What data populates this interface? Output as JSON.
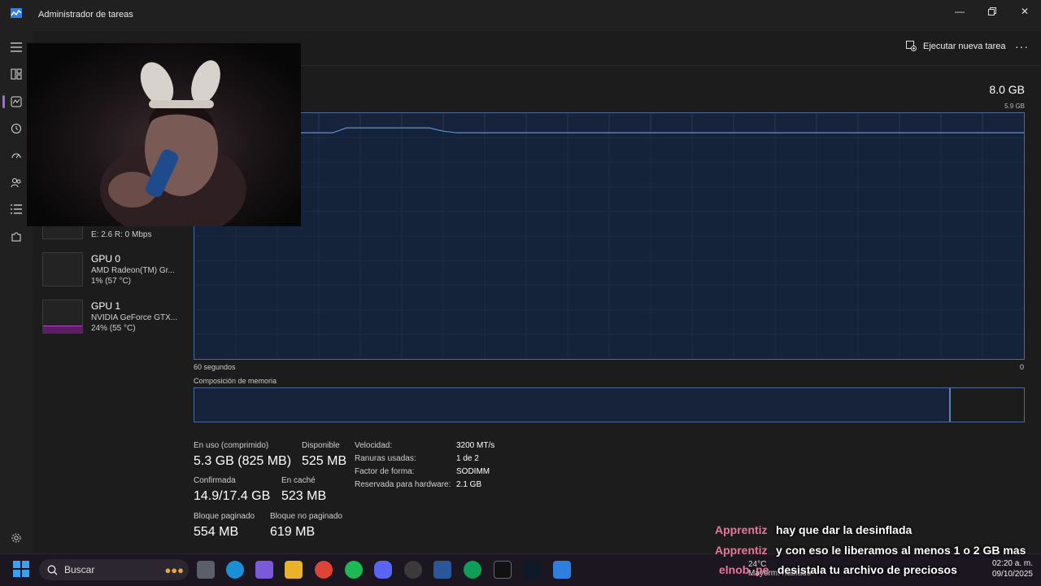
{
  "window": {
    "title": "Administrador de tareas"
  },
  "commandbar": {
    "run_task_label": "Ejecutar nueva tarea"
  },
  "memory": {
    "total": "8.0 GB",
    "chart_max": "5.9 GB",
    "axis_left": "60 segundos",
    "axis_right": "0",
    "composition_title": "Composición de memoria",
    "usage_fraction_of_chart": 0.92,
    "composition_used_fraction": 0.912
  },
  "stats": {
    "in_use_label": "En uso (comprimido)",
    "in_use_value": "5.3 GB (825 MB)",
    "available_label": "Disponible",
    "available_value": "525 MB",
    "committed_label": "Confirmada",
    "committed_value": "14.9/17.4 GB",
    "cached_label": "En caché",
    "cached_value": "523 MB",
    "paged_label": "Bloque paginado",
    "paged_value": "554 MB",
    "nonpaged_label": "Bloque no paginado",
    "nonpaged_value": "619 MB",
    "speed_label": "Velocidad:",
    "speed_value": "3200 MT/s",
    "slots_label": "Ranuras usadas:",
    "slots_value": "1 de 2",
    "form_label": "Factor de forma:",
    "form_value": "SODIMM",
    "reserved_label": "Reservada para hardware:",
    "reserved_value": "2.1 GB"
  },
  "devices": {
    "network_sub": "E: 2.6 R: 0 Mbps",
    "gpu0_name": "GPU 0",
    "gpu0_model": "AMD Radeon(TM) Gr...",
    "gpu0_usage": "1% (57 °C)",
    "gpu1_name": "GPU 1",
    "gpu1_model": "NVIDIA GeForce GTX...",
    "gpu1_usage": "24% (55 °C)"
  },
  "chat": [
    {
      "user": "Apprentiz",
      "message": "hay que dar la desinflada"
    },
    {
      "user": "Apprentiz",
      "message": "y con eso le liberamos al menos 1 o 2 GB mas"
    },
    {
      "user": "elnob_pe",
      "message": "desistala tu archivo de preciosos"
    }
  ],
  "taskbar": {
    "search_label": "Buscar",
    "weather_temp": "24°C",
    "weather_desc": "Mayorm. nublado",
    "time": "02:20 a. m.",
    "date": "09/10/2025"
  },
  "colors": {
    "accent": "#9d6cd8",
    "chart_fill": "#16233b",
    "chart_border": "#4e6a94",
    "chart_line": "#5c8fd0",
    "chat_name": "#e6789a"
  }
}
